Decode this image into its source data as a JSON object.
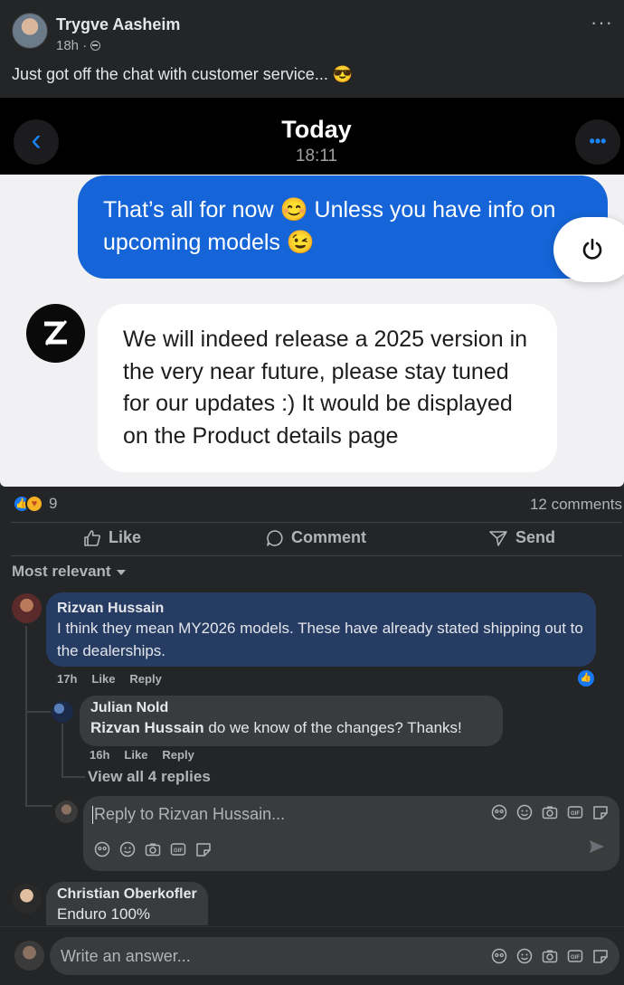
{
  "post": {
    "author": "Trygve Aasheim",
    "time": "18h ·",
    "text": "Just got off the chat with customer service... 😎",
    "more_icon": "more-dots-icon"
  },
  "screenshot": {
    "title": "Today",
    "time": "18:11",
    "outgoing_message": "That’s all for now 😊 Unless you have info on upcoming models 😉",
    "incoming_message": "We will indeed release a 2025 version in the very near future, please stay tuned for our updates :) It would be displayed on the Product details page"
  },
  "stats": {
    "reaction_count": "9",
    "comments": "12 comments"
  },
  "actions": {
    "like": "Like",
    "comment": "Comment",
    "send": "Send"
  },
  "filter": {
    "label": "Most relevant"
  },
  "comments": [
    {
      "name": "Rizvan Hussain",
      "text": "I think they mean MY2026 models. These have already stated shipping out to the dealerships.",
      "time": "17h",
      "like": "Like",
      "reply": "Reply"
    },
    {
      "name": "Julian Nold",
      "mention": "Rizvan Hussain",
      "text": " do we know of the changes? Thanks!",
      "time": "16h",
      "like": "Like",
      "reply": "Reply"
    },
    {
      "name": "Christian Oberkofler",
      "text": "Enduro 100%"
    }
  ],
  "view_replies": "View all 4 replies",
  "reply_box": {
    "placeholder": "Reply to Rizvan Hussain..."
  },
  "answer_box": {
    "placeholder": "Write an answer..."
  },
  "colors": {
    "accent": "#1877f2",
    "outgoing_bubble": "#1565d8",
    "highlight_comment": "#263c63"
  }
}
